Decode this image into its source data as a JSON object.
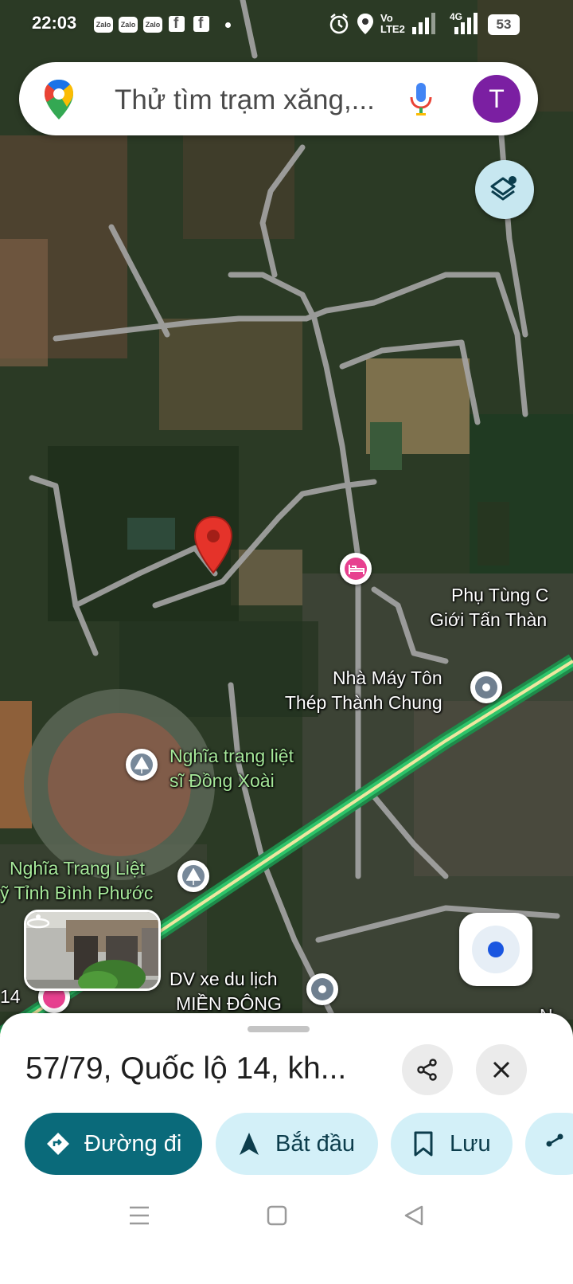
{
  "status_bar": {
    "time": "22:03",
    "notification_icons": [
      "Zalo",
      "Zalo",
      "Zalo",
      "facebook-icon",
      "facebook-icon"
    ],
    "network_label_top": "Vo",
    "network_label_bottom": "LTE2",
    "network_4g": "4G",
    "battery_level": "53"
  },
  "search": {
    "placeholder": "Thử tìm trạm xăng,...",
    "avatar_initial": "T"
  },
  "map_labels": {
    "phu_tung_line1": "Phụ Tùng C",
    "phu_tung_line2": "Giới Tấn Thàn",
    "nha_may_line1": "Nhà Máy Tôn",
    "nha_may_line2": "Thép Thành Chung",
    "nghia_trang_ds_line1": "Nghĩa trang liệt",
    "nghia_trang_ds_line2": "sĩ Đồng Xoài",
    "nghia_trang_bp_line1": "Nghĩa Trang Liệt",
    "nghia_trang_bp_line2": "ỹ Tỉnh Bình Phước",
    "dv_xe_line1": "DV xe du lịch",
    "dv_xe_line2": "MIỀN ĐÔNG",
    "road_14": "14",
    "edge_n": "N"
  },
  "place": {
    "title": "57/79, Quốc lộ 14, kh..."
  },
  "actions": {
    "directions": "Đường đi",
    "start": "Bắt đầu",
    "save": "Lưu"
  },
  "colors": {
    "directions_chip": "#0a6a7a",
    "secondary_chip": "#d3f0f8",
    "pin_red": "#e5332a",
    "highway": "#2ec46a",
    "avatar": "#7b1fa2"
  }
}
